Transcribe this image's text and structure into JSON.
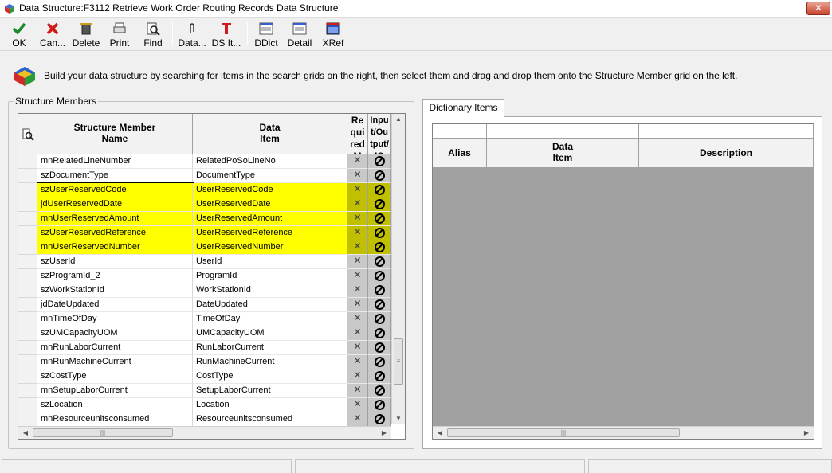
{
  "window": {
    "title": "Data Structure:F3112 Retrieve Work Order Routing Records Data Structure",
    "close_label": "✕"
  },
  "toolbar": [
    {
      "label": "OK",
      "icon": "check-icon"
    },
    {
      "label": "Can...",
      "icon": "cancel-icon"
    },
    {
      "label": "Delete",
      "icon": "trash-icon"
    },
    {
      "label": "Print",
      "icon": "print-icon"
    },
    {
      "label": "Find",
      "icon": "find-icon"
    },
    {
      "label": "Data...",
      "icon": "paperclip-icon"
    },
    {
      "label": "DS It...",
      "icon": "ds-item-icon"
    },
    {
      "label": "DDict",
      "icon": "ddict-icon"
    },
    {
      "label": "Detail",
      "icon": "detail-icon"
    },
    {
      "label": "XRef",
      "icon": "xref-icon"
    }
  ],
  "info": {
    "text": "Build your data structure by searching for items in the search grids on the right, then select them and drag and drop them onto the Structure Member grid on the left."
  },
  "structure_members": {
    "group_label": "Structure Members",
    "columns": {
      "name": "Structure Member\nName",
      "item": "Data\nItem",
      "required": "Re\nqui\nred\nM",
      "io": "Inpu\nt/Ou\ntput/\nIO"
    },
    "rows": [
      {
        "name": "mnRelatedLineNumber",
        "item": "RelatedPoSoLineNo",
        "highlight": false
      },
      {
        "name": "szDocumentType",
        "item": "DocumentType",
        "highlight": false
      },
      {
        "name": "szUserReservedCode",
        "item": "UserReservedCode",
        "highlight": true
      },
      {
        "name": "jdUserReservedDate",
        "item": "UserReservedDate",
        "highlight": true
      },
      {
        "name": "mnUserReservedAmount",
        "item": "UserReservedAmount",
        "highlight": true
      },
      {
        "name": "szUserReservedReference",
        "item": "UserReservedReference",
        "highlight": true
      },
      {
        "name": "mnUserReservedNumber",
        "item": "UserReservedNumber",
        "highlight": true
      },
      {
        "name": "szUserId",
        "item": "UserId",
        "highlight": false
      },
      {
        "name": "szProgramId_2",
        "item": "ProgramId",
        "highlight": false
      },
      {
        "name": "szWorkStationId",
        "item": "WorkStationId",
        "highlight": false
      },
      {
        "name": "jdDateUpdated",
        "item": "DateUpdated",
        "highlight": false
      },
      {
        "name": "mnTimeOfDay",
        "item": "TimeOfDay",
        "highlight": false
      },
      {
        "name": "szUMCapacityUOM",
        "item": "UMCapacityUOM",
        "highlight": false
      },
      {
        "name": "mnRunLaborCurrent",
        "item": "RunLaborCurrent",
        "highlight": false
      },
      {
        "name": "mnRunMachineCurrent",
        "item": "RunMachineCurrent",
        "highlight": false
      },
      {
        "name": "szCostType",
        "item": "CostType",
        "highlight": false
      },
      {
        "name": "mnSetupLaborCurrent",
        "item": "SetupLaborCurrent",
        "highlight": false
      },
      {
        "name": "szLocation",
        "item": "Location",
        "highlight": false
      },
      {
        "name": "mnResourceunitsconsumed",
        "item": "Resourceunitsconsumed",
        "highlight": false
      }
    ]
  },
  "dictionary": {
    "tab_label": "Dictionary Items",
    "columns": {
      "alias": "Alias",
      "item": "Data\nItem",
      "description": "Description"
    }
  },
  "colors": {
    "highlight": "#ffff00",
    "cell_highlight": "#c0c000",
    "empty_grid": "#a0a0a0"
  }
}
